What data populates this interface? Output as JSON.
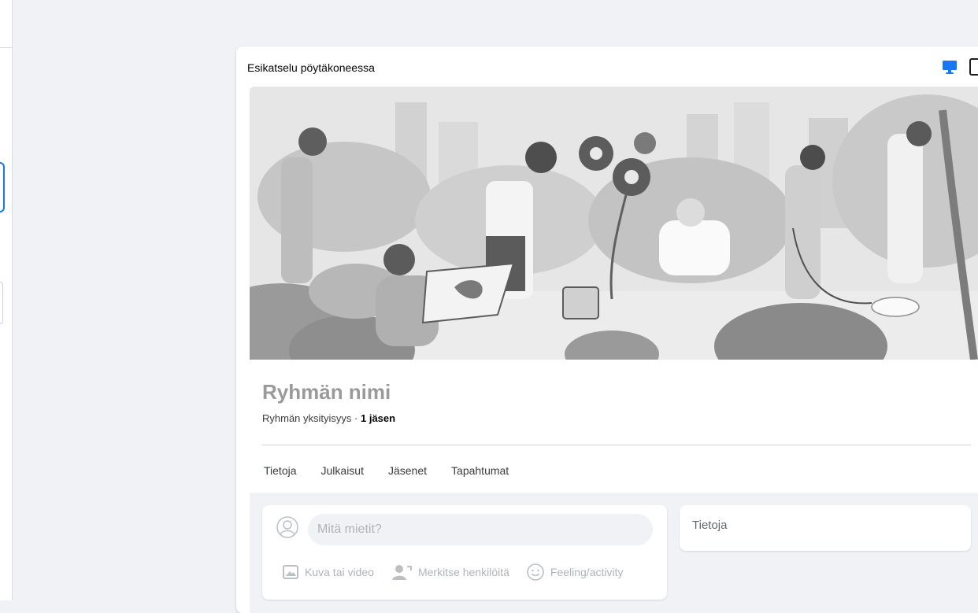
{
  "preview": {
    "title": "Esikatselu pöytäkoneessa"
  },
  "group": {
    "name": "Ryhmän nimi",
    "privacy": "Ryhmän yksityisyys",
    "separator": " · ",
    "members": "1 jäsen"
  },
  "tabs": [
    {
      "label": "Tietoja"
    },
    {
      "label": "Julkaisut"
    },
    {
      "label": "Jäsenet"
    },
    {
      "label": "Tapahtumat"
    }
  ],
  "composer": {
    "placeholder": "Mitä mietit?",
    "actions": [
      {
        "label": "Kuva tai video",
        "icon": "photo-video-icon"
      },
      {
        "label": "Merkitse henkilöitä",
        "icon": "tag-people-icon"
      },
      {
        "label": "Feeling/activity",
        "icon": "smiley-icon"
      }
    ]
  },
  "about": {
    "title": "Tietoja"
  },
  "colors": {
    "accent": "#1877f2",
    "background": "#f0f2f5"
  }
}
